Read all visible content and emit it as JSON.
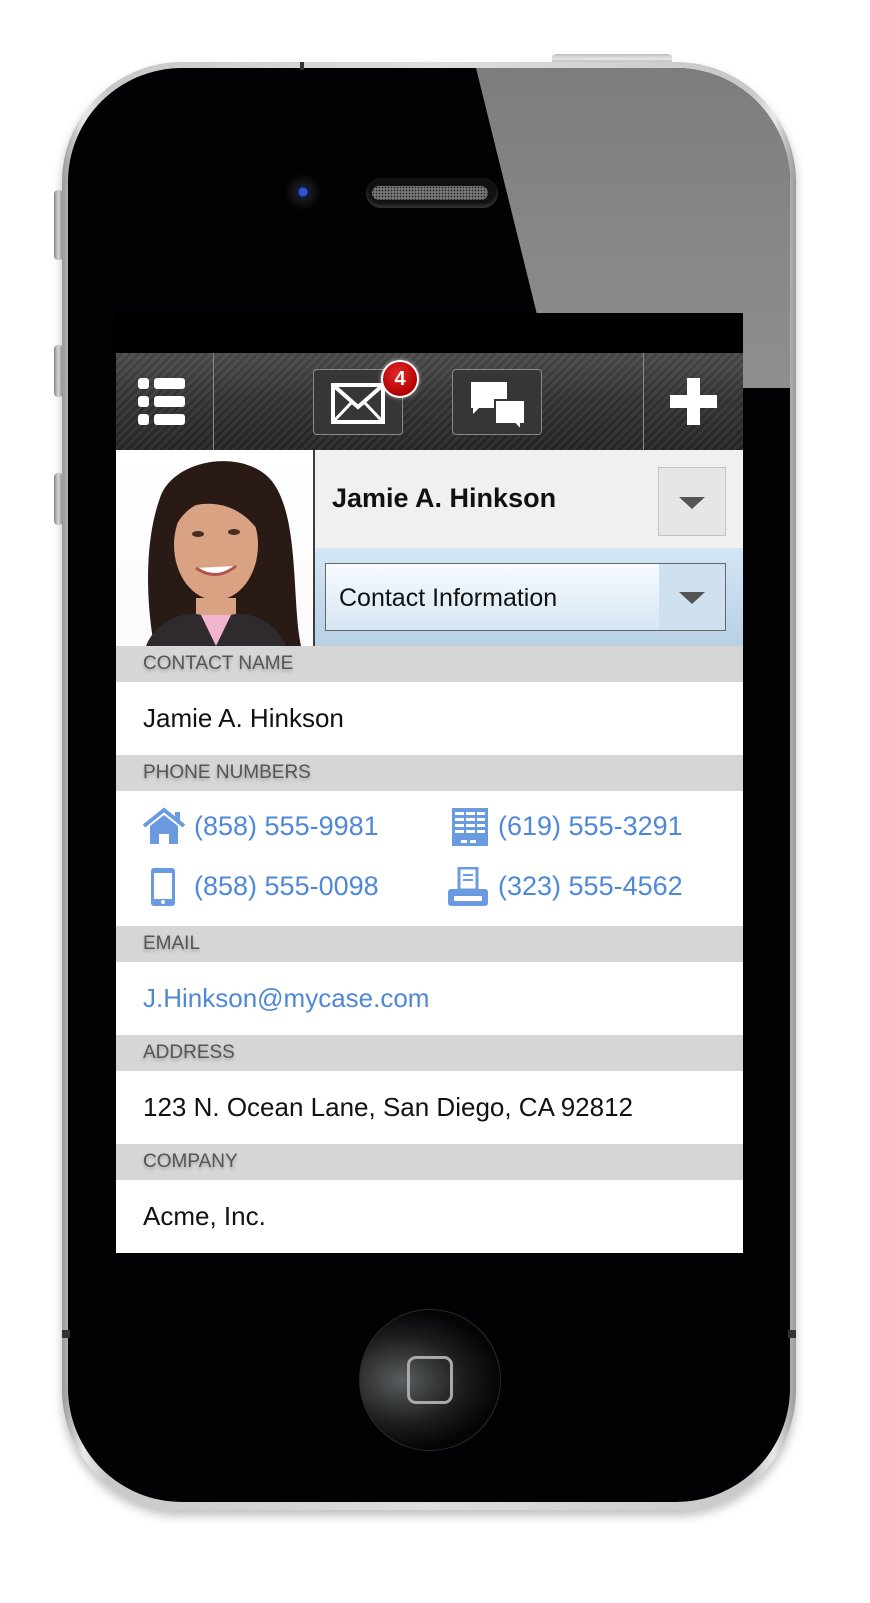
{
  "toolbar": {
    "menu_icon": "list-icon",
    "mail_icon": "envelope-icon",
    "mail_badge": "4",
    "chat_icon": "chat-bubbles-icon",
    "add_icon": "plus-icon"
  },
  "profile": {
    "name": "Jamie A. Hinkson",
    "section_selector": "Contact Information",
    "photo_alt": "Contact photo"
  },
  "sections": {
    "contact_name": {
      "label": "CONTACT NAME",
      "value": "Jamie A. Hinkson"
    },
    "phone_numbers": {
      "label": "PHONE NUMBERS",
      "items": [
        {
          "type": "home",
          "icon": "home-icon",
          "number": "(858) 555-9981"
        },
        {
          "type": "work",
          "icon": "office-building-icon",
          "number": "(619) 555-3291"
        },
        {
          "type": "mobile",
          "icon": "mobile-phone-icon",
          "number": "(858) 555-0098"
        },
        {
          "type": "fax",
          "icon": "fax-icon",
          "number": "(323) 555-4562"
        }
      ]
    },
    "email": {
      "label": "EMAIL",
      "value": "J.Hinkson@mycase.com"
    },
    "address": {
      "label": "ADDRESS",
      "value": "123 N. Ocean Lane, San Diego, CA 92812"
    },
    "company": {
      "label": "COMPANY",
      "value": "Acme, Inc."
    }
  },
  "colors": {
    "link": "#4f88d8",
    "badge": "#c40a0a",
    "section_header_bg": "#d6d6d6",
    "selector_bg": "#d3e6f5"
  }
}
